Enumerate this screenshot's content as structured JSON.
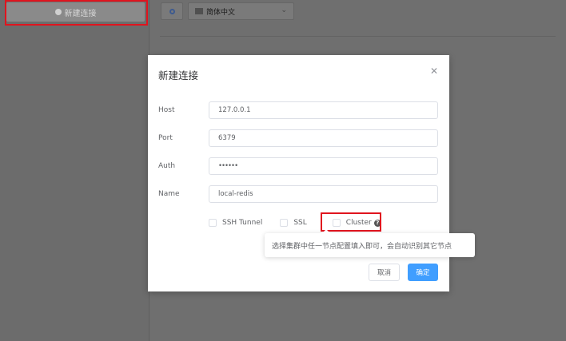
{
  "sidebar": {
    "new_connection_label": "新建连接"
  },
  "toolbar": {
    "language": "简体中文"
  },
  "dialog": {
    "title": "新建连接",
    "fields": [
      {
        "label": "Host",
        "value": "127.0.0.1"
      },
      {
        "label": "Port",
        "value": "6379"
      },
      {
        "label": "Auth",
        "value": "••••••"
      },
      {
        "label": "Name",
        "value": "local-redis"
      }
    ],
    "checkboxes": {
      "ssh": "SSH Tunnel",
      "ssl": "SSL",
      "cluster": "Cluster"
    },
    "cluster_tooltip": "选择集群中任一节点配置填入即可，会自动识别其它节点",
    "cancel_label": "取消",
    "ok_label": "确定"
  },
  "colors": {
    "primary": "#409eff",
    "highlight": "#e0141e"
  }
}
